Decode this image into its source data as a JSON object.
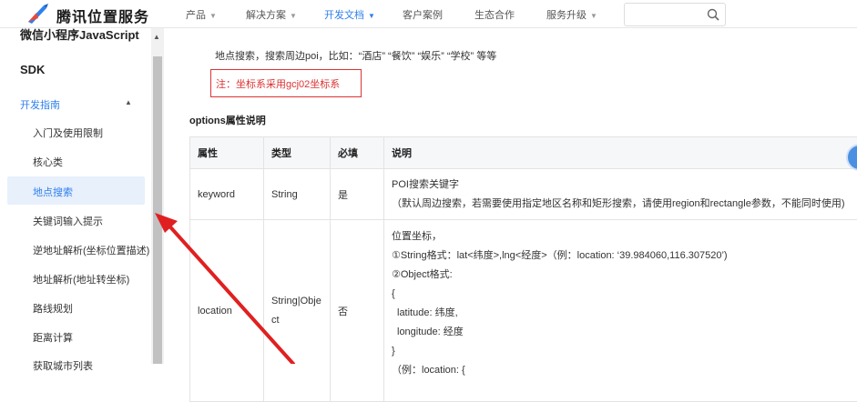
{
  "header": {
    "brand": "腾讯位置服务",
    "nav": [
      {
        "label": "产品",
        "caret": true,
        "active": false
      },
      {
        "label": "解决方案",
        "caret": true,
        "active": false
      },
      {
        "label": "开发文档",
        "caret": true,
        "active": true
      },
      {
        "label": "客户案例",
        "caret": false,
        "active": false
      },
      {
        "label": "生态合作",
        "caret": false,
        "active": false
      },
      {
        "label": "服务升级",
        "caret": true,
        "active": false
      }
    ],
    "search_placeholder": ""
  },
  "sidebar": {
    "cut_title": "微信小程序JavaScript",
    "sdk": "SDK",
    "section": "开发指南",
    "items": [
      {
        "label": "入门及使用限制"
      },
      {
        "label": "核心类"
      },
      {
        "label": "地点搜索",
        "active": true
      },
      {
        "label": "关键词输入提示"
      },
      {
        "label": "逆地址解析(坐标位置描述)"
      },
      {
        "label": "地址解析(地址转坐标)"
      },
      {
        "label": "路线规划"
      },
      {
        "label": "距离计算"
      },
      {
        "label": "获取城市列表"
      }
    ]
  },
  "content": {
    "desc": "地点搜索，搜索周边poi，比如：“酒店” “餐饮” “娱乐” “学校” 等等",
    "note": "注：坐标系采用gcj02坐标系",
    "section_title": "options属性说明",
    "table": {
      "headers": [
        "属性",
        "类型",
        "必填",
        "说明"
      ],
      "rows": [
        {
          "name": "keyword",
          "type": "String",
          "required": "是",
          "desc_lines": [
            "POI搜索关键字",
            "（默认周边搜索，若需要使用指定地区名称和矩形搜索，请使用region和rectangle参数，不能同时使用)"
          ]
        },
        {
          "name": "location",
          "type_lines": [
            "String|Obje",
            "ct"
          ],
          "required": "否",
          "desc_lines": [
            "位置坐标，",
            "①String格式：lat<纬度>,lng<经度>（例：location: ‘39.984060,116.307520’)",
            "②Object格式:",
            "{",
            "  latitude: 纬度,",
            "  longitude: 经度",
            "}",
            "（例：location: {"
          ]
        }
      ]
    }
  },
  "colors": {
    "accent": "#2f80ed",
    "note_red": "#dd3333",
    "arrow_red": "#e02020"
  }
}
